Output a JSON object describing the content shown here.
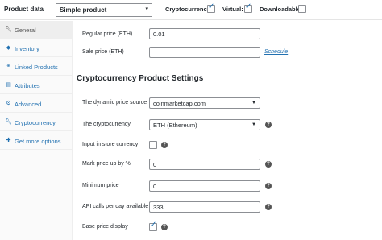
{
  "header": {
    "title": "Product data",
    "product_type": "Simple product",
    "cryptocurrency_label": "Cryptocurrency:",
    "cryptocurrency_checked": true,
    "virtual_label": "Virtual:",
    "virtual_checked": true,
    "downloadable_label": "Downloadable:",
    "downloadable_checked": false
  },
  "sidebar": {
    "items": [
      {
        "label": "General",
        "icon": "wrench-icon",
        "active": true
      },
      {
        "label": "Inventory",
        "icon": "clipboard-icon",
        "active": false
      },
      {
        "label": "Linked Products",
        "icon": "link-icon",
        "active": false
      },
      {
        "label": "Attributes",
        "icon": "list-icon",
        "active": false
      },
      {
        "label": "Advanced",
        "icon": "gear-icon",
        "active": false
      },
      {
        "label": "Cryptocurrency",
        "icon": "wrench-icon",
        "active": false
      },
      {
        "label": "Get more options",
        "icon": "plugin-icon",
        "active": false
      }
    ]
  },
  "general": {
    "regular_price_label": "Regular price (ETH)",
    "regular_price_value": "0.01",
    "sale_price_label": "Sale price (ETH)",
    "sale_price_value": "",
    "schedule_link": "Schedule"
  },
  "crypto": {
    "section_title": "Cryptocurrency Product Settings",
    "price_source_label": "The dynamic price source",
    "price_source_value": "coinmarketcap.com",
    "cryptocurrency_label": "The cryptocurrency",
    "cryptocurrency_value": "ETH (Ethereum)",
    "input_store_currency_label": "Input in store currency",
    "input_store_currency_checked": false,
    "markup_label": "Mark price up by %",
    "markup_value": "0",
    "minimum_price_label": "Minimum price",
    "minimum_price_value": "0",
    "api_calls_label": "API calls per day available",
    "api_calls_value": "333",
    "base_price_display_label": "Base price display",
    "base_price_display_checked": true
  },
  "colors": {
    "accent": "#2271b1",
    "sidebar_bg": "#fafafa",
    "active_tab_bg": "#eeeeee"
  }
}
